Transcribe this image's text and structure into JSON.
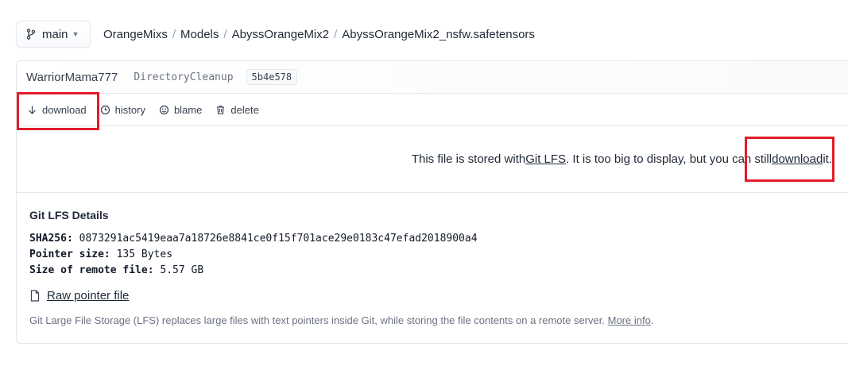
{
  "branch": {
    "label": "main",
    "icon": "git-branch-icon"
  },
  "breadcrumb": {
    "items": [
      "OrangeMixs",
      "Models",
      "AbyssOrangeMix2",
      "AbyssOrangeMix2_nsfw.safetensors"
    ],
    "separator": "/"
  },
  "commit": {
    "author": "WarriorMama777",
    "message": "DirectoryCleanup",
    "hash": "5b4e578"
  },
  "actions": [
    {
      "label": "download",
      "icon": "arrow-down-icon"
    },
    {
      "label": "history",
      "icon": "clock-icon"
    },
    {
      "label": "blame",
      "icon": "smiley-icon"
    },
    {
      "label": "delete",
      "icon": "trash-icon"
    }
  ],
  "lfs_message": {
    "prefix": "This file is stored with ",
    "link_lfs": "Git LFS",
    "middle": " . It is too big to display, but you can still ",
    "link_download": "download",
    "suffix": " it."
  },
  "details": {
    "title": "Git LFS Details",
    "sha_label": "SHA256:",
    "sha_value": "0873291ac5419eaa7a18726e8841ce0f15f701ace29e0183c47efad2018900a4",
    "pointer_label": "Pointer size:",
    "pointer_value": "135 Bytes",
    "remote_label": "Size of remote file:",
    "remote_value": "5.57 GB",
    "raw_link": "Raw pointer file",
    "footnote_text": "Git Large File Storage (LFS) replaces large files with text pointers inside Git, while storing the file contents on a remote server. ",
    "footnote_link": "More info",
    "footnote_end": "."
  },
  "colors": {
    "highlight": "#e11d2a",
    "border": "#e5e7eb"
  }
}
